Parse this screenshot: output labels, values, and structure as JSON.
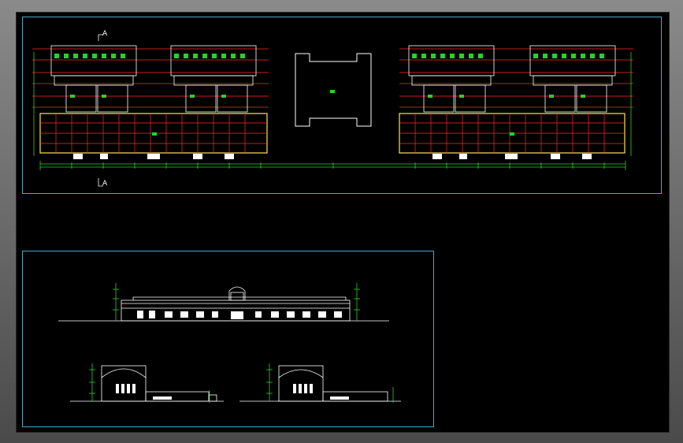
{
  "viewport": {
    "background": "#000000",
    "frame_color": "#6e6e6e",
    "sheet_border_color": "#4aa7c9"
  },
  "plan_view": {
    "section_marker_top": "A",
    "section_marker_bottom": "A",
    "colors": {
      "building_outline": "#ffffff",
      "grid": "#ff2a2a",
      "dimension": "#2bd02b",
      "hatch": "#ffe840",
      "label": "#2bd02b"
    }
  },
  "elevations": {
    "colors": {
      "line": "#ffffff",
      "dimension": "#2bd02b"
    }
  }
}
